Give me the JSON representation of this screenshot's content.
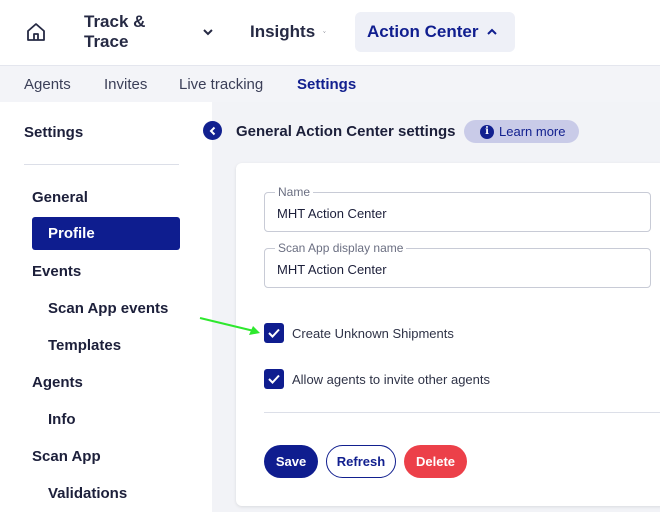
{
  "nav": {
    "home_icon": "home-icon",
    "items": [
      {
        "label": "Track & Trace",
        "icon": "chevron-down-icon"
      },
      {
        "label": "Insights",
        "icon": "chevron-down-icon"
      },
      {
        "label": "Action Center",
        "icon": "chevron-up-icon",
        "active": true
      }
    ]
  },
  "subnav": {
    "tabs": [
      {
        "label": "Agents"
      },
      {
        "label": "Invites"
      },
      {
        "label": "Live tracking"
      },
      {
        "label": "Settings",
        "active": true
      }
    ]
  },
  "sidebar": {
    "title": "Settings",
    "groups": [
      {
        "label": "General",
        "items": [
          {
            "label": "Profile",
            "active": true
          }
        ]
      },
      {
        "label": "Events",
        "items": [
          {
            "label": "Scan App events"
          },
          {
            "label": "Templates"
          }
        ]
      },
      {
        "label": "Agents",
        "items": [
          {
            "label": "Info"
          }
        ]
      },
      {
        "label": "Scan App",
        "items": [
          {
            "label": "Validations"
          }
        ]
      }
    ]
  },
  "main": {
    "collapse_icon": "chevron-left-icon",
    "title": "General Action Center settings",
    "learn_more": {
      "label": "Learn more",
      "icon": "info-icon"
    },
    "fields": [
      {
        "label": "Name",
        "value": "MHT Action Center"
      },
      {
        "label": "Scan App display name",
        "value": "MHT Action Center"
      }
    ],
    "checkboxes": [
      {
        "label": "Create Unknown Shipments",
        "checked": true
      },
      {
        "label": "Allow agents to invite other agents",
        "checked": true
      }
    ],
    "buttons": {
      "save": "Save",
      "refresh": "Refresh",
      "delete": "Delete"
    }
  },
  "colors": {
    "brand": "#0f1d8f",
    "danger": "#ec4049",
    "annotation_arrow": "#2ee82e"
  }
}
